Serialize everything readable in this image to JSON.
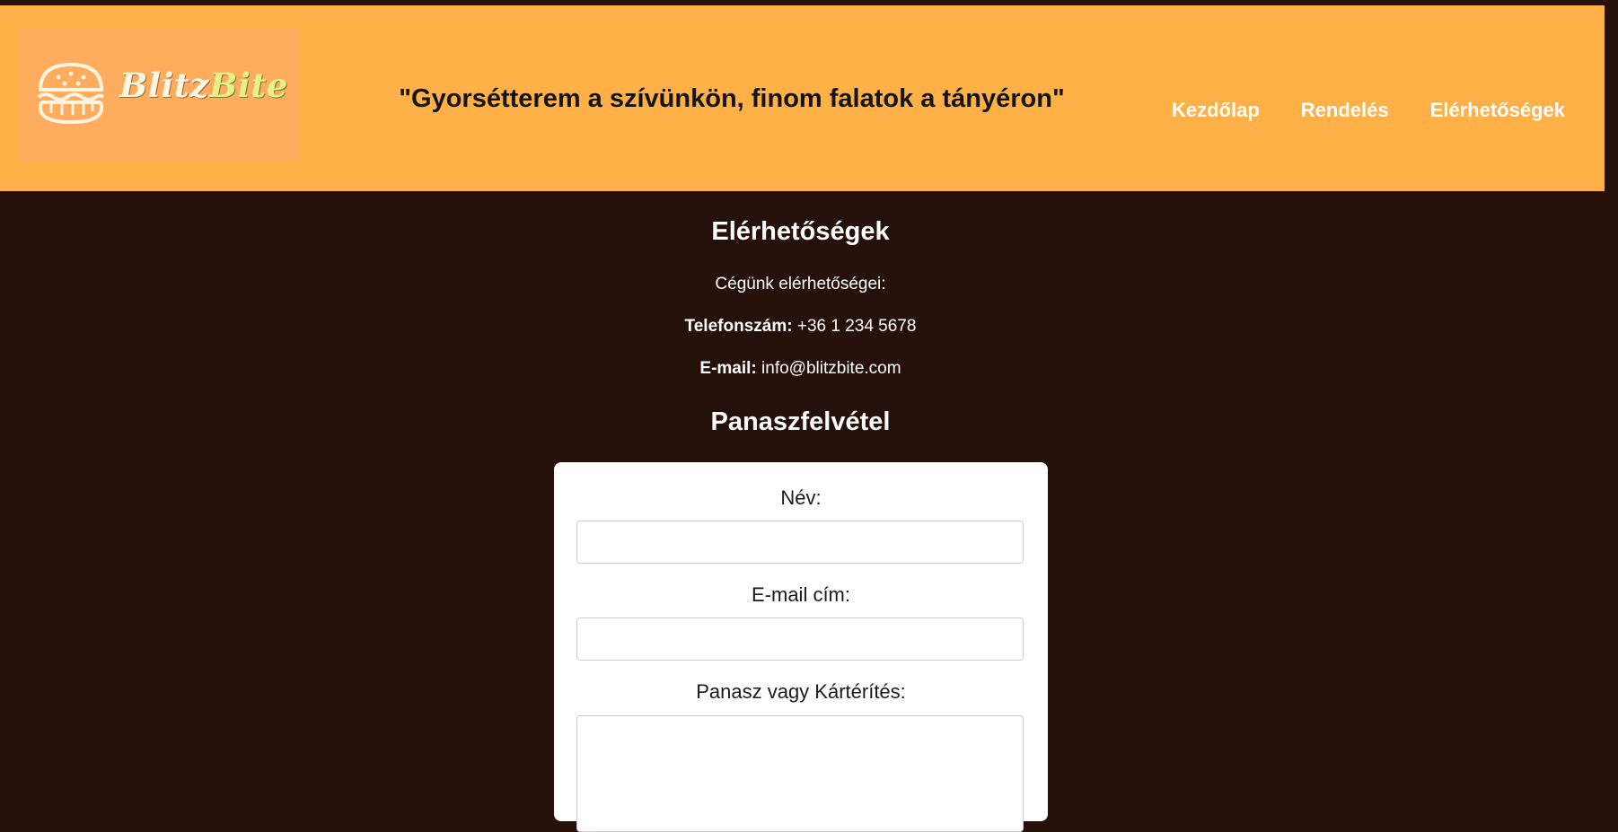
{
  "brand": {
    "logo_text_part1": "Blitz",
    "logo_text_part2": "Bite",
    "logo_icon": "burger-icon"
  },
  "header": {
    "slogan": "\"Gyorsétterem a szívünkön, finom falatok a tányéron\""
  },
  "nav": {
    "items": [
      {
        "label": "Kezdőlap"
      },
      {
        "label": "Rendelés"
      },
      {
        "label": "Elérhetőségek"
      }
    ]
  },
  "contact": {
    "title": "Elérhetőségek",
    "intro": "Cégünk elérhetőségei:",
    "phone_label": "Telefonszám:",
    "phone_value": "+36 1 234 5678",
    "email_label": "E-mail:",
    "email_value": "info@blitzbite.com"
  },
  "complaint": {
    "title": "Panaszfelvétel",
    "name_label": "Név:",
    "email_label": "E-mail cím:",
    "message_label": "Panasz vagy Kártérítés:"
  },
  "colors": {
    "header_bg": "#ffb046",
    "page_bg": "#26110a",
    "logo_bg": "#ffac5e",
    "nav_text": "#ffffff",
    "form_bg": "#ffffff"
  }
}
